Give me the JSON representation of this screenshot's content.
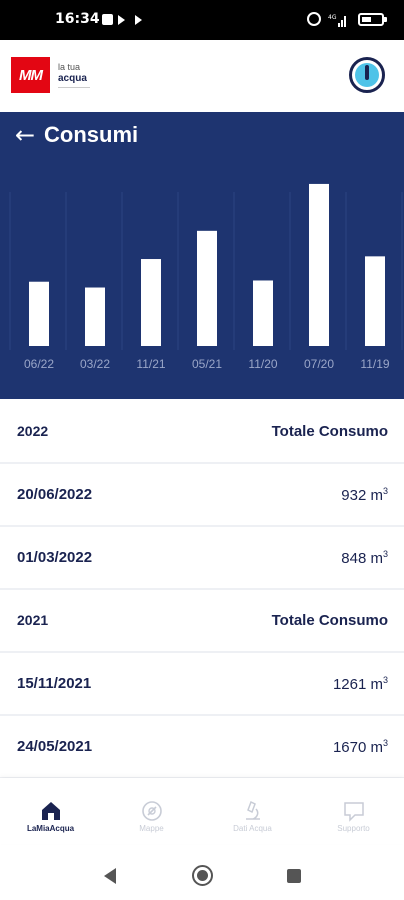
{
  "status_bar": {
    "time": "16:34",
    "signal_text": "4G",
    "battery_level": 0.5
  },
  "header": {
    "logo_mark": "MM",
    "logo_line1": "la tua",
    "logo_line2": "acqua",
    "status_icon": "water-status-gauge-icon"
  },
  "page": {
    "title": "Consumi",
    "back_icon": "arrow-left-icon"
  },
  "chart_data": {
    "type": "bar",
    "categories": [
      "06/22",
      "03/22",
      "11/21",
      "05/21",
      "11/20",
      "07/20",
      "11/19"
    ],
    "values": [
      932,
      848,
      1261,
      1670,
      950,
      2350,
      1300
    ],
    "ylim": [
      0,
      2900
    ],
    "grid": "vertical",
    "bar_color": "#ffffff",
    "background": "#1e3470"
  },
  "list": {
    "rows": [
      {
        "type": "header",
        "left": "2022",
        "right": "Totale Consumo"
      },
      {
        "type": "item",
        "left": "20/06/2022",
        "value": "932",
        "unit": "m",
        "unit_sup": "3"
      },
      {
        "type": "item",
        "left": "01/03/2022",
        "value": "848",
        "unit": "m",
        "unit_sup": "3"
      },
      {
        "type": "header",
        "left": "2021",
        "right": "Totale Consumo"
      },
      {
        "type": "item",
        "left": "15/11/2021",
        "value": "1261",
        "unit": "m",
        "unit_sup": "3"
      },
      {
        "type": "item",
        "left": "24/05/2021",
        "value": "1670",
        "unit": "m",
        "unit_sup": "3"
      }
    ]
  },
  "bottom_nav": {
    "items": [
      {
        "label": "LaMiaAcqua",
        "icon": "home-icon",
        "active": true
      },
      {
        "label": "Mappe",
        "icon": "map-pin-icon",
        "active": false
      },
      {
        "label": "Dati Acqua",
        "icon": "microscope-icon",
        "active": false
      },
      {
        "label": "Supporto",
        "icon": "chat-bubble-icon",
        "active": false
      }
    ]
  },
  "colors": {
    "primary": "#1e3470",
    "text": "#1a2350",
    "brand_red": "#e30613",
    "accent": "#4fc3e8",
    "inactive": "#c8ccd6"
  }
}
